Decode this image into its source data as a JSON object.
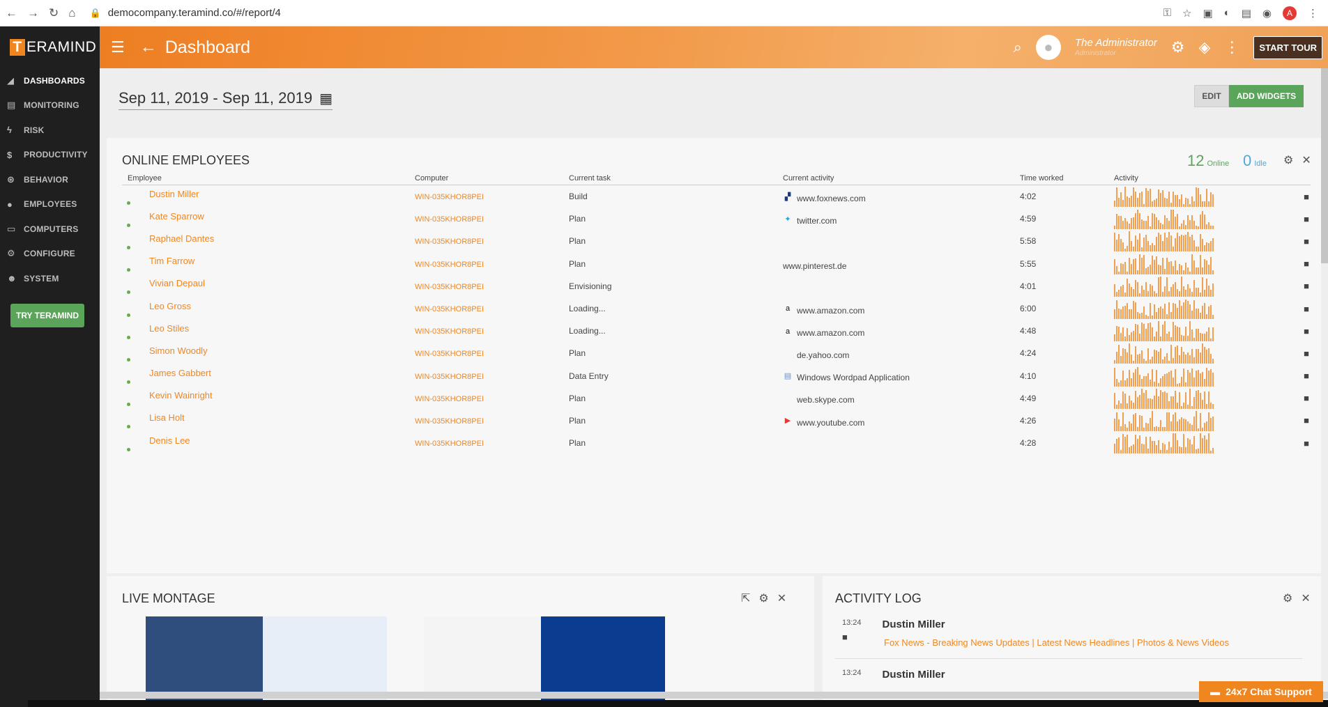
{
  "browser": {
    "url": "democompany.teramind.co/#/report/4"
  },
  "sidebar": {
    "logo_letter": "T",
    "logo_text": "ERAMIND",
    "items": [
      {
        "label": "DASHBOARDS",
        "icon": "chart-icon"
      },
      {
        "label": "MONITORING",
        "icon": "document-icon"
      },
      {
        "label": "RISK",
        "icon": "bolt-icon"
      },
      {
        "label": "PRODUCTIVITY",
        "icon": "dollar-icon"
      },
      {
        "label": "BEHAVIOR",
        "icon": "gamepad-icon"
      },
      {
        "label": "EMPLOYEES",
        "icon": "person-icon"
      },
      {
        "label": "COMPUTERS",
        "icon": "monitor-icon"
      },
      {
        "label": "CONFIGURE",
        "icon": "gear-icon"
      },
      {
        "label": "SYSTEM",
        "icon": "user-gear-icon"
      }
    ],
    "try_button": "TRY TERAMIND"
  },
  "header": {
    "title": "Dashboard",
    "user_name": "The Administrator",
    "user_role": "Administrator",
    "start_tour": "START TOUR"
  },
  "toolbar": {
    "date_range": "Sep 11, 2019 - Sep 11, 2019",
    "edit": "EDIT",
    "add_widgets": "ADD WIDGETS"
  },
  "online": {
    "title": "ONLINE EMPLOYEES",
    "online_count": "12",
    "online_label": "Online",
    "idle_count": "0",
    "idle_label": "Idle",
    "columns": [
      "Employee",
      "Computer",
      "Current task",
      "Current activity",
      "Time worked",
      "Activity"
    ],
    "rows": [
      {
        "name": "Dustin Miller",
        "computer": "WIN-035KHOR8PEI",
        "task": "Build",
        "activity": "www.foxnews.com",
        "time": "4:02"
      },
      {
        "name": "Kate Sparrow",
        "computer": "WIN-035KHOR8PEI",
        "task": "Plan",
        "activity": "twitter.com",
        "time": "4:59"
      },
      {
        "name": "Raphael Dantes",
        "computer": "WIN-035KHOR8PEI",
        "task": "Plan",
        "activity": "",
        "time": "5:58"
      },
      {
        "name": "Tim Farrow",
        "computer": "WIN-035KHOR8PEI",
        "task": "Plan",
        "activity": "www.pinterest.de",
        "time": "5:55"
      },
      {
        "name": "Vivian Depaul",
        "computer": "WIN-035KHOR8PEI",
        "task": "Envisioning",
        "activity": "",
        "time": "4:01"
      },
      {
        "name": "Leo Gross",
        "computer": "WIN-035KHOR8PEI",
        "task": "Loading...",
        "activity": "www.amazon.com",
        "time": "6:00"
      },
      {
        "name": "Leo Stiles",
        "computer": "WIN-035KHOR8PEI",
        "task": "Loading...",
        "activity": "www.amazon.com",
        "time": "4:48"
      },
      {
        "name": "Simon Woodly",
        "computer": "WIN-035KHOR8PEI",
        "task": "Plan",
        "activity": "de.yahoo.com",
        "time": "4:24"
      },
      {
        "name": "James Gabbert",
        "computer": "WIN-035KHOR8PEI",
        "task": "Data Entry",
        "activity": "Windows Wordpad Application",
        "time": "4:10"
      },
      {
        "name": "Kevin Wainright",
        "computer": "WIN-035KHOR8PEI",
        "task": "Plan",
        "activity": "web.skype.com",
        "time": "4:49"
      },
      {
        "name": "Lisa Holt",
        "computer": "WIN-035KHOR8PEI",
        "task": "Plan",
        "activity": "www.youtube.com",
        "time": "4:26"
      },
      {
        "name": "Denis Lee",
        "computer": "WIN-035KHOR8PEI",
        "task": "Plan",
        "activity": "",
        "time": "4:28"
      }
    ]
  },
  "montage": {
    "title": "LIVE MONTAGE"
  },
  "log": {
    "title": "ACTIVITY LOG",
    "entries": [
      {
        "time": "13:24",
        "name": "Dustin Miller",
        "link": "Fox News - Breaking News Updates | Latest News Headlines | Photos & News Videos"
      },
      {
        "time": "13:24",
        "name": "Dustin Miller",
        "link": ""
      }
    ]
  },
  "chat": {
    "label": "24x7 Chat Support"
  },
  "colors": {
    "accent": "#f0861f",
    "online": "#5aa55a",
    "idle": "#4fa8d6"
  }
}
